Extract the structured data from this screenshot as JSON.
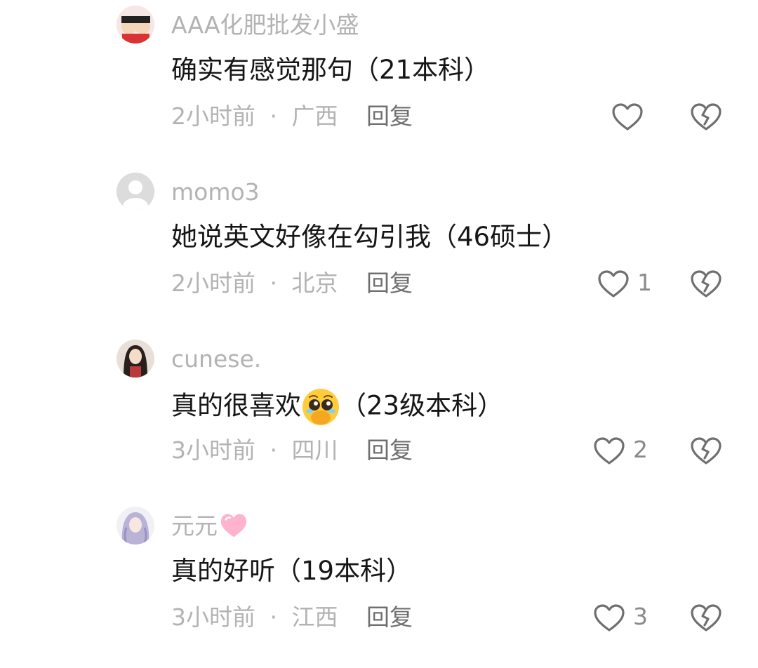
{
  "comments": [
    {
      "username": "AAA化肥批发小盛",
      "content": "确实有感觉那句（21本科）",
      "time": "2小时前",
      "location": "广西",
      "reply_label": "回复",
      "likes": ""
    },
    {
      "username": "momo3",
      "content": "她说英文好像在勾引我（46硕士）",
      "time": "2小时前",
      "location": "北京",
      "reply_label": "回复",
      "likes": "1"
    },
    {
      "username": "cunese.",
      "content_before_emoji": "真的很喜欢",
      "content_after_emoji": "（23级本科）",
      "emoji": "pleading-face-emoji",
      "time": "3小时前",
      "location": "四川",
      "reply_label": "回复",
      "likes": "2"
    },
    {
      "username": "元元",
      "username_emoji": "pink-heart-emoji",
      "content": "真的好听（19本科）",
      "time": "3小时前",
      "location": "江西",
      "reply_label": "回复",
      "likes": "3"
    }
  ],
  "meta_separator": "·",
  "colors": {
    "username": "#b3b3b3",
    "content": "#161616",
    "meta": "#b3b3b3",
    "reply": "#6f6f6f",
    "icon": "#6f6f6f"
  }
}
